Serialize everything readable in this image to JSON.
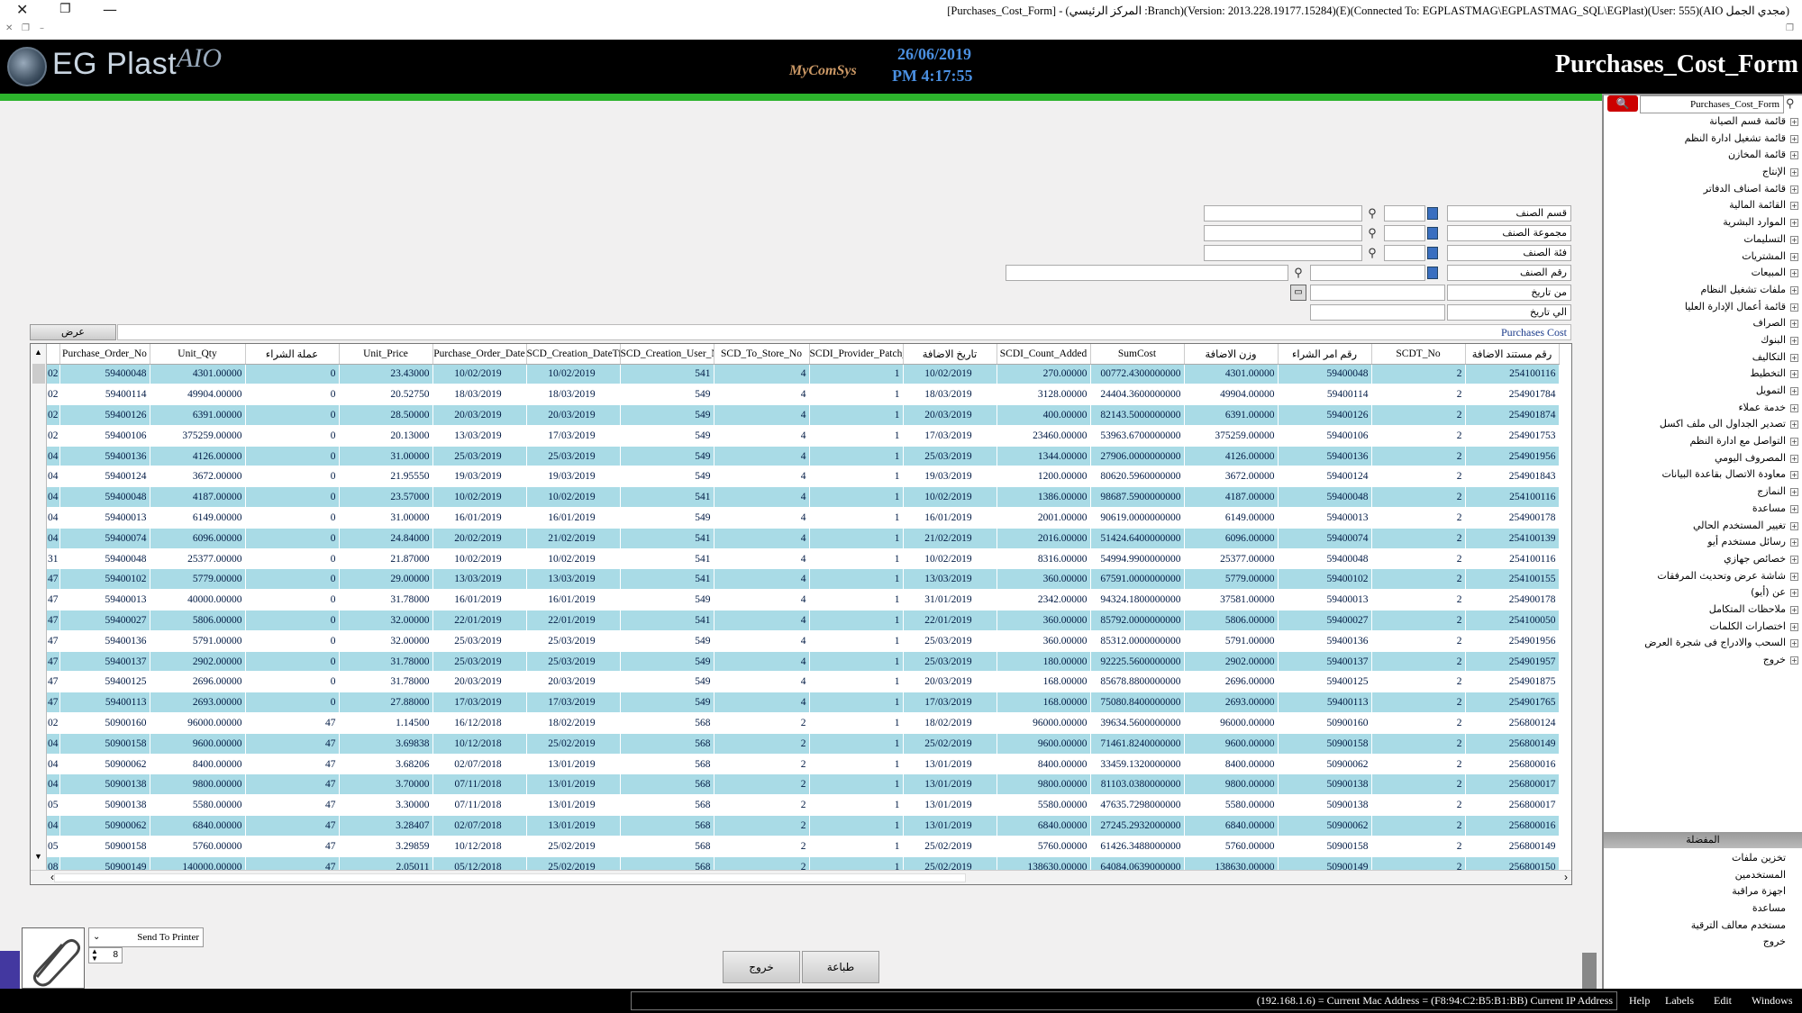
{
  "window": {
    "title": "[Purchases_Cost_Form] - (المركز الرئيسي :Branch)(Version: 2013.228.19177.15284)(E)(Connected To: EGPLASTMAG\\EGPLASTMAG_SQL\\EGPlast)(User: 555)(AIO مجدي الجمل)"
  },
  "header": {
    "logo_text": "EG Plast",
    "logo_suffix": "AIO",
    "vendor": "MyComSys",
    "date": "26/06/2019",
    "time": "PM 4:17:55",
    "form_title": "Purchases_Cost_Form"
  },
  "sidebar": {
    "search_value": "Purchases_Cost_Form",
    "items": [
      "قائمة قسم الصيانة",
      "قائمة تشغيل ادارة النظم",
      "قائمة المخازن",
      "الإنتاج",
      "قائمة اصناف الدفاتر",
      "القائمة المالية",
      "الموارد البشرية",
      "التسليمات",
      "المشتريات",
      "المبيعات",
      "ملفات تشغيل النظام",
      "قائمة أعمال الإدارة العليا",
      "الصراف",
      "البنوك",
      "التكاليف",
      "التخطيط",
      "التمويل",
      "خدمة عملاء",
      "تصدير الجداول الى ملف اكسل",
      "التواصل مع ادارة النظم",
      "المصروف اليومي",
      "معاودة الاتصال بقاعدة البيانات",
      "النمازج",
      "مساعدة",
      "تغيير المستخدم الحالي",
      "رسائل مستخدم أيو",
      "خصائص جهازي",
      "شاشة عرض وتحديث المرفقات",
      "عن (أيو)",
      "ملاحظات المتكامل",
      "اختصارات الكلمات",
      "السحب والادراج فى شجرة العرض",
      "خروج"
    ],
    "section_label": "المفضلة",
    "favorites": [
      "تخزين ملفات",
      "المستخدمين",
      "اجهزة مراقبة",
      "مساعدة",
      "مستخدم معالف الترقية",
      "خروج"
    ]
  },
  "filters": {
    "category_label": "قسم الصنف",
    "group_label": "مجموعة الصنف",
    "class_label": "فئة الصنف",
    "item_no_label": "رقم الصنف",
    "from_date_label": "من تاريخ",
    "to_date_label": "الي تاريخ"
  },
  "grid": {
    "title": "Purchases Cost",
    "view_button": "عرض",
    "columns": [
      "",
      "Purchase_Order_No",
      "Unit_Qty",
      "عملة الشراء",
      "Unit_Price",
      "Purchase_Order_Date",
      "SCD_Creation_DateTime",
      "SCD_Creation_User_No",
      "SCD_To_Store_No",
      "SCDI_Provider_Patch_No",
      "تاريخ الاضافة",
      "SCDI_Count_Added",
      "SumCost",
      "وزن الاضافة",
      "رقم امر الشراء",
      "SCDT_No",
      "رقم مستند الاضافة"
    ],
    "rows": [
      [
        "02",
        "59400048",
        "4301.00000",
        "0",
        "23.43000",
        "10/02/2019",
        "10/02/2019",
        "541",
        "4",
        "1",
        "10/02/2019",
        "270.00000",
        "00772.4300000000",
        "4301.00000",
        "59400048",
        "2",
        "254100116"
      ],
      [
        "02",
        "59400114",
        "49904.00000",
        "0",
        "20.52750",
        "18/03/2019",
        "18/03/2019",
        "549",
        "4",
        "1",
        "18/03/2019",
        "3128.00000",
        "24404.3600000000",
        "49904.00000",
        "59400114",
        "2",
        "254901784"
      ],
      [
        "02",
        "59400126",
        "6391.00000",
        "0",
        "28.50000",
        "20/03/2019",
        "20/03/2019",
        "549",
        "4",
        "1",
        "20/03/2019",
        "400.00000",
        "82143.5000000000",
        "6391.00000",
        "59400126",
        "2",
        "254901874"
      ],
      [
        "02",
        "59400106",
        "375259.00000",
        "0",
        "20.13000",
        "13/03/2019",
        "17/03/2019",
        "549",
        "4",
        "1",
        "17/03/2019",
        "23460.00000",
        "53963.6700000000",
        "375259.00000",
        "59400106",
        "2",
        "254901753"
      ],
      [
        "04",
        "59400136",
        "4126.00000",
        "0",
        "31.00000",
        "25/03/2019",
        "25/03/2019",
        "549",
        "4",
        "1",
        "25/03/2019",
        "1344.00000",
        "27906.0000000000",
        "4126.00000",
        "59400136",
        "2",
        "254901956"
      ],
      [
        "04",
        "59400124",
        "3672.00000",
        "0",
        "21.95550",
        "19/03/2019",
        "19/03/2019",
        "549",
        "4",
        "1",
        "19/03/2019",
        "1200.00000",
        "80620.5960000000",
        "3672.00000",
        "59400124",
        "2",
        "254901843"
      ],
      [
        "04",
        "59400048",
        "4187.00000",
        "0",
        "23.57000",
        "10/02/2019",
        "10/02/2019",
        "541",
        "4",
        "1",
        "10/02/2019",
        "1386.00000",
        "98687.5900000000",
        "4187.00000",
        "59400048",
        "2",
        "254100116"
      ],
      [
        "04",
        "59400013",
        "6149.00000",
        "0",
        "31.00000",
        "16/01/2019",
        "16/01/2019",
        "549",
        "4",
        "1",
        "16/01/2019",
        "2001.00000",
        "90619.0000000000",
        "6149.00000",
        "59400013",
        "2",
        "254900178"
      ],
      [
        "04",
        "59400074",
        "6096.00000",
        "0",
        "24.84000",
        "20/02/2019",
        "21/02/2019",
        "541",
        "4",
        "1",
        "21/02/2019",
        "2016.00000",
        "51424.6400000000",
        "6096.00000",
        "59400074",
        "2",
        "254100139"
      ],
      [
        "31",
        "59400048",
        "25377.00000",
        "0",
        "21.87000",
        "10/02/2019",
        "10/02/2019",
        "541",
        "4",
        "1",
        "10/02/2019",
        "8316.00000",
        "54994.9900000000",
        "25377.00000",
        "59400048",
        "2",
        "254100116"
      ],
      [
        "47",
        "59400102",
        "5779.00000",
        "0",
        "29.00000",
        "13/03/2019",
        "13/03/2019",
        "541",
        "4",
        "1",
        "13/03/2019",
        "360.00000",
        "67591.0000000000",
        "5779.00000",
        "59400102",
        "2",
        "254100155"
      ],
      [
        "47",
        "59400013",
        "40000.00000",
        "0",
        "31.78000",
        "16/01/2019",
        "16/01/2019",
        "549",
        "4",
        "1",
        "31/01/2019",
        "2342.00000",
        "94324.1800000000",
        "37581.00000",
        "59400013",
        "2",
        "254900178"
      ],
      [
        "47",
        "59400027",
        "5806.00000",
        "0",
        "32.00000",
        "22/01/2019",
        "22/01/2019",
        "541",
        "4",
        "1",
        "22/01/2019",
        "360.00000",
        "85792.0000000000",
        "5806.00000",
        "59400027",
        "2",
        "254100050"
      ],
      [
        "47",
        "59400136",
        "5791.00000",
        "0",
        "32.00000",
        "25/03/2019",
        "25/03/2019",
        "549",
        "4",
        "1",
        "25/03/2019",
        "360.00000",
        "85312.0000000000",
        "5791.00000",
        "59400136",
        "2",
        "254901956"
      ],
      [
        "47",
        "59400137",
        "2902.00000",
        "0",
        "31.78000",
        "25/03/2019",
        "25/03/2019",
        "549",
        "4",
        "1",
        "25/03/2019",
        "180.00000",
        "92225.5600000000",
        "2902.00000",
        "59400137",
        "2",
        "254901957"
      ],
      [
        "47",
        "59400125",
        "2696.00000",
        "0",
        "31.78000",
        "20/03/2019",
        "20/03/2019",
        "549",
        "4",
        "1",
        "20/03/2019",
        "168.00000",
        "85678.8800000000",
        "2696.00000",
        "59400125",
        "2",
        "254901875"
      ],
      [
        "47",
        "59400113",
        "2693.00000",
        "0",
        "27.88000",
        "17/03/2019",
        "17/03/2019",
        "549",
        "4",
        "1",
        "17/03/2019",
        "168.00000",
        "75080.8400000000",
        "2693.00000",
        "59400113",
        "2",
        "254901765"
      ],
      [
        "02",
        "50900160",
        "96000.00000",
        "47",
        "1.14500",
        "16/12/2018",
        "18/02/2019",
        "568",
        "2",
        "1",
        "18/02/2019",
        "96000.00000",
        "39634.5600000000",
        "96000.00000",
        "50900160",
        "2",
        "256800124"
      ],
      [
        "04",
        "50900158",
        "9600.00000",
        "47",
        "3.69838",
        "10/12/2018",
        "25/02/2019",
        "568",
        "2",
        "1",
        "25/02/2019",
        "9600.00000",
        "71461.8240000000",
        "9600.00000",
        "50900158",
        "2",
        "256800149"
      ],
      [
        "04",
        "50900062",
        "8400.00000",
        "47",
        "3.68206",
        "02/07/2018",
        "13/01/2019",
        "568",
        "2",
        "1",
        "13/01/2019",
        "8400.00000",
        "33459.1320000000",
        "8400.00000",
        "50900062",
        "2",
        "256800016"
      ],
      [
        "04",
        "50900138",
        "9800.00000",
        "47",
        "3.70000",
        "07/11/2018",
        "13/01/2019",
        "568",
        "2",
        "1",
        "13/01/2019",
        "9800.00000",
        "81103.0380000000",
        "9800.00000",
        "50900138",
        "2",
        "256800017"
      ],
      [
        "05",
        "50900138",
        "5580.00000",
        "47",
        "3.30000",
        "07/11/2018",
        "13/01/2019",
        "568",
        "2",
        "1",
        "13/01/2019",
        "5580.00000",
        "47635.7298000000",
        "5580.00000",
        "50900138",
        "2",
        "256800017"
      ],
      [
        "04",
        "50900062",
        "6840.00000",
        "47",
        "3.28407",
        "02/07/2018",
        "13/01/2019",
        "568",
        "2",
        "1",
        "13/01/2019",
        "6840.00000",
        "27245.2932000000",
        "6840.00000",
        "50900062",
        "2",
        "256800016"
      ],
      [
        "05",
        "50900158",
        "5760.00000",
        "47",
        "3.29859",
        "10/12/2018",
        "25/02/2019",
        "568",
        "2",
        "1",
        "25/02/2019",
        "5760.00000",
        "61426.3488000000",
        "5760.00000",
        "50900158",
        "2",
        "256800149"
      ],
      [
        "08",
        "50900149",
        "140000.00000",
        "47",
        "2.05011",
        "05/12/2018",
        "25/02/2019",
        "568",
        "2",
        "1",
        "25/02/2019",
        "138630.00000",
        "64084.0639000000",
        "138630.00000",
        "50900149",
        "2",
        "256800150"
      ]
    ]
  },
  "bottom": {
    "printer_label": "Send To Printer",
    "copies": "8",
    "print_button": "طباعة",
    "exit_button": "خروج"
  },
  "status": {
    "ip_text": "(192.168.1.6) = Current Mac Address = (F8:94:C2:B5:B1:BB) Current IP Address",
    "menu": [
      "Help",
      "Labels",
      "Edit",
      "Windows"
    ]
  },
  "colors": {
    "row_highlight": "#a9dbe6",
    "header_bg": "#000000",
    "accent_green": "#2db42d",
    "date_blue": "#4a8fe0"
  }
}
